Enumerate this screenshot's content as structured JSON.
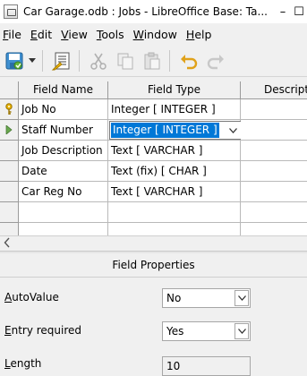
{
  "window": {
    "title": "Car Garage.odb : Jobs - LibreOffice Base: Ta...",
    "minimize": "–",
    "maximize": "☐"
  },
  "menu": [
    {
      "label": "File",
      "accel": "F",
      "rest": "ile"
    },
    {
      "label": "Edit",
      "accel": "E",
      "rest": "dit"
    },
    {
      "label": "View",
      "accel": "V",
      "rest": "iew"
    },
    {
      "label": "Tools",
      "accel": "T",
      "rest": "ools"
    },
    {
      "label": "Window",
      "accel": "W",
      "rest": "indow"
    },
    {
      "label": "Help",
      "accel": "H",
      "rest": "elp"
    }
  ],
  "toolbar": {
    "icons": [
      "save-icon",
      "dropdown-arrow-icon",
      "index-design-icon",
      "cut-icon",
      "copy-icon",
      "paste-icon",
      "undo-icon",
      "redo-icon"
    ]
  },
  "grid": {
    "headers": [
      "Field Name",
      "Field Type",
      "Description"
    ],
    "rows": [
      {
        "name": "Job No",
        "type": "Integer [ INTEGER ]",
        "marker": "key-icon"
      },
      {
        "name": "Staff Number",
        "type": "Integer [ INTEGER ]",
        "marker": "current-row-arrow-icon",
        "selected": true
      },
      {
        "name": "Job Description",
        "type": "Text [ VARCHAR ]",
        "marker": ""
      },
      {
        "name": "Date",
        "type": "Text (fix) [ CHAR ]",
        "marker": ""
      },
      {
        "name": "Car Reg No",
        "type": "Text [ VARCHAR ]",
        "marker": ""
      },
      {
        "name": "",
        "type": "",
        "marker": ""
      },
      {
        "name": "",
        "type": "",
        "marker": ""
      }
    ]
  },
  "properties": {
    "header": "Field Properties",
    "autovalue": {
      "accel": "A",
      "rest": "utoValue",
      "value": "No"
    },
    "required": {
      "accel": "E",
      "rest": "ntry required",
      "value": "Yes"
    },
    "length": {
      "accel": "L",
      "rest": "ength",
      "value": "10"
    }
  },
  "colors": {
    "selection": "#0078d7",
    "key": "#e8b400",
    "arrow": "#6aa84f",
    "undo": "#e0a21b"
  }
}
